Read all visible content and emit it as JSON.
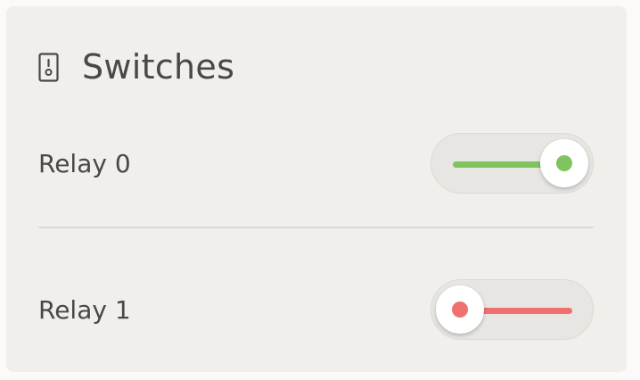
{
  "card": {
    "title": "Switches",
    "icon": "wall-switch-icon"
  },
  "relays": [
    {
      "label": "Relay 0",
      "state": "on",
      "color": "#7fc45f"
    },
    {
      "label": "Relay 1",
      "state": "off",
      "color": "#f07070"
    }
  ]
}
